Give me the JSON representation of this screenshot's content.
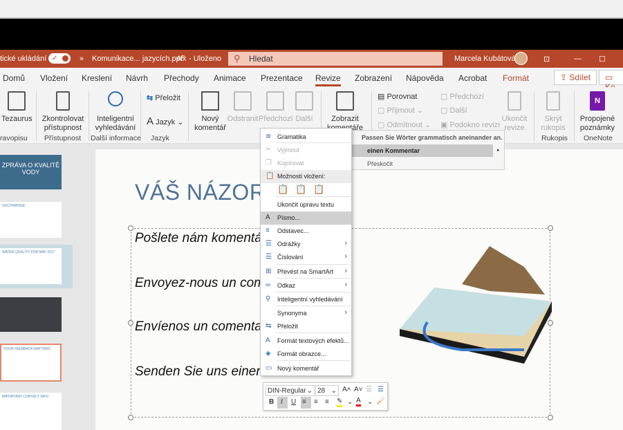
{
  "titlebar": {
    "autosave": "tické ukládání",
    "autosave_state": "on",
    "file": "Komunikace... jazycích.pptx",
    "saved": "- Uloženo",
    "search_placeholder": "Hledat",
    "user": "Marcela Kubátová",
    "accent": "#b7472a"
  },
  "tabs": [
    {
      "label": "Domů"
    },
    {
      "label": "Vložení"
    },
    {
      "label": "Kreslení"
    },
    {
      "label": "Návrh"
    },
    {
      "label": "Přechody"
    },
    {
      "label": "Animace"
    },
    {
      "label": "Prezentace"
    },
    {
      "label": "Revize",
      "active": true
    },
    {
      "label": "Zobrazení"
    },
    {
      "label": "Nápověda"
    },
    {
      "label": "Acrobat"
    },
    {
      "label": "Formát"
    }
  ],
  "share": "Sdílet",
  "comments": "Ko",
  "ribbon": {
    "tezaurus": "Tezaurus",
    "zkontrolovat": "Zkontrolovat přístupnost",
    "inteligentni": "Inteligentní vyhledávání",
    "prelozit": "Přeložit",
    "jazyk": "Jazyk",
    "novy": "Nový komentář",
    "odstranit": "Odstranit",
    "predchozi": "Předchozí",
    "dalsi": "Další",
    "zobrazit": "Zobrazit komentáře",
    "porovnat": "Porovnat",
    "prijmout": "Přijmout",
    "odmitnout": "Odmítnout",
    "predchozi2": "Předchozí",
    "dalsi2": "Další",
    "podokno": "Podokno revizí",
    "ukoncit": "Ukončit revize",
    "skryt": "Skrýt rukopis",
    "propojene": "Propojené poznámky",
    "groups": {
      "pravopis": "ravopisu",
      "pristupnost": "Přístupnost",
      "dalsi_info": "Další informace",
      "jazyk": "Jazyk",
      "rukopis": "Rukopis",
      "onenote": "OneNote"
    }
  },
  "thumbs": [
    "ZPRÁVA O KVALITĚ VODY",
    "SOUTHRIDGE",
    "WATER QUALITY FOR MAY 2017",
    "",
    "YOUR FEEDBACK MATTERS",
    "IMPORTANT CONTACT INFO"
  ],
  "slide": {
    "title": "VÁŠ NÁZOR",
    "lines": [
      "Pošlete nám komentář",
      "Envoyez-nous un commentaire",
      "Envíenos un comentario",
      "Senden Sie uns einen Kommentar"
    ]
  },
  "context_menu": {
    "items": [
      {
        "label": "Gramatika",
        "icon": "grammar-icon"
      },
      {
        "label": "Vyjmout",
        "icon": "scissors-icon",
        "disabled": true
      },
      {
        "label": "Kopírovat",
        "icon": "copy-icon",
        "disabled": true
      },
      {
        "label": "Možnosti vložení:",
        "icon": "paste-icon"
      },
      {
        "label": "Ukončit úpravu textu"
      },
      {
        "label": "Písmo...",
        "icon": "font-icon",
        "highlighted": true
      },
      {
        "label": "Odstavec...",
        "icon": "paragraph-icon"
      },
      {
        "label": "Odrážky",
        "icon": "bullets-icon",
        "submenu": true
      },
      {
        "label": "Číslování",
        "icon": "numbering-icon",
        "submenu": true
      },
      {
        "label": "Převést na SmartArt",
        "icon": "smartart-icon",
        "submenu": true
      },
      {
        "label": "Odkaz",
        "icon": "link-icon",
        "submenu": true
      },
      {
        "label": "Inteligentní vyhledávání",
        "icon": "search-icon"
      },
      {
        "label": "Synonyma",
        "submenu": true
      },
      {
        "label": "Přeložit",
        "icon": "translate-icon"
      },
      {
        "label": "Formát textových efektů...",
        "icon": "text-effects-icon"
      },
      {
        "label": "Formát obrazce...",
        "icon": "shape-format-icon"
      },
      {
        "label": "Nový komentář",
        "icon": "comment-icon"
      }
    ]
  },
  "submenu": {
    "header": "Passen Sie Wörter grammatisch aneinander an.",
    "suggestion": "einen Kommentar",
    "skip": "Přeskočit"
  },
  "mini_toolbar": {
    "font": "DIN-Regular",
    "size": "28"
  }
}
